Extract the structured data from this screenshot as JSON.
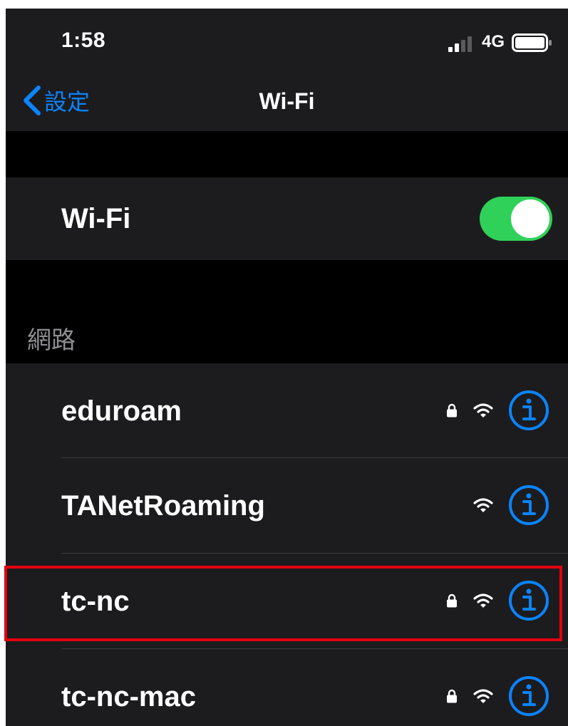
{
  "status_bar": {
    "time": "1:58",
    "network_type": "4G",
    "signal_icon": "cellular-signal-icon",
    "battery_icon": "battery-icon"
  },
  "nav": {
    "back_label": "設定",
    "back_icon": "chevron-left-icon",
    "title": "Wi-Fi"
  },
  "wifi_toggle": {
    "label": "Wi-Fi",
    "on": true
  },
  "networks_section": {
    "header": "網路",
    "items": [
      {
        "name": "eduroam",
        "secured": true,
        "highlighted": false
      },
      {
        "name": "TANetRoaming",
        "secured": false,
        "highlighted": false
      },
      {
        "name": "tc-nc",
        "secured": true,
        "highlighted": true
      },
      {
        "name": "tc-nc-mac",
        "secured": true,
        "highlighted": false
      }
    ]
  },
  "colors": {
    "accent": "#0a84ff",
    "toggle_on": "#30d158",
    "highlight": "#e3000f",
    "cell_background": "#1c1c1e",
    "grouped_background": "#000000",
    "secondary_label": "#8e8e93"
  }
}
